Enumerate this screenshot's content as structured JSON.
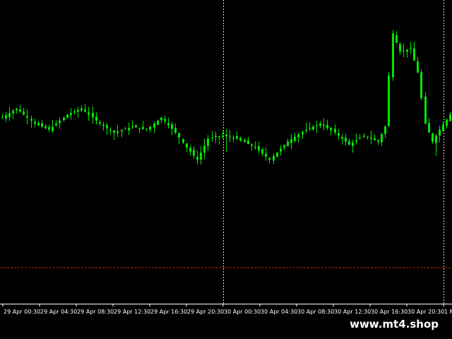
{
  "chart_data": {
    "type": "candlestick",
    "x_tick_labels": [
      "29 Apr 00:30",
      "29 Apr 04:30",
      "29 Apr 08:30",
      "29 Apr 12:30",
      "29 Apr 16:30",
      "29 Apr 20:30",
      "30 Apr 00:30",
      "30 Apr 04:30",
      "30 Apr 08:30",
      "30 Apr 12:30",
      "30 Apr 16:30",
      "30 Apr 20:30",
      "1 M"
    ],
    "ylim": [
      0,
      100
    ],
    "separator_line_level": 12,
    "day_separators_at_ticks": [
      "29 Apr 20:30",
      "30 Apr 20:30"
    ],
    "bar_count": 125,
    "close_profile": [
      [
        0,
        62
      ],
      [
        4,
        65
      ],
      [
        9,
        60
      ],
      [
        13,
        58
      ],
      [
        18,
        63
      ],
      [
        22,
        65
      ],
      [
        27,
        60
      ],
      [
        31,
        57
      ],
      [
        36,
        59
      ],
      [
        40,
        58
      ],
      [
        44,
        62
      ],
      [
        48,
        57
      ],
      [
        51,
        52
      ],
      [
        54,
        48
      ],
      [
        57,
        55
      ],
      [
        61,
        56
      ],
      [
        65,
        55
      ],
      [
        70,
        52
      ],
      [
        74,
        48
      ],
      [
        79,
        54
      ],
      [
        84,
        58
      ],
      [
        88,
        60
      ],
      [
        92,
        57
      ],
      [
        96,
        53
      ],
      [
        100,
        56
      ],
      [
        104,
        54
      ],
      [
        106,
        59
      ],
      [
        107,
        76
      ],
      [
        108,
        90
      ],
      [
        110,
        84
      ],
      [
        113,
        85
      ],
      [
        115,
        77
      ],
      [
        117,
        60
      ],
      [
        119,
        54
      ],
      [
        121,
        58
      ],
      [
        124,
        63
      ]
    ],
    "colors": {
      "candle": "#00e600",
      "background": "#000000",
      "grid": "#ffffff",
      "level_line": "#cc2222"
    }
  },
  "watermark": {
    "text": "www.mt4.shop"
  }
}
